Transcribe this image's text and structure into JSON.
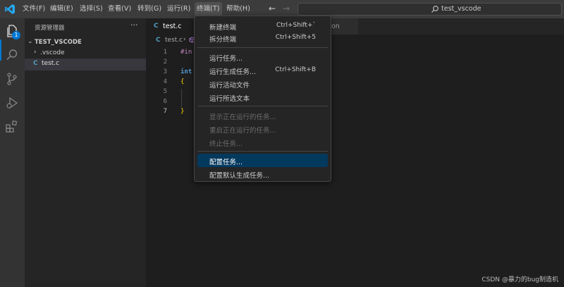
{
  "menubar": {
    "items": [
      "文件(F)",
      "编辑(E)",
      "选择(S)",
      "查看(V)",
      "转到(G)",
      "运行(R)",
      "终端(T)",
      "帮助(H)"
    ],
    "active": "终端(T)"
  },
  "search": {
    "text": "test_vscode"
  },
  "activity_bar": {
    "explorer_badge": "1"
  },
  "sidebar": {
    "title": "资源管理器",
    "more": "···",
    "folder": "TEST_VSCODE",
    "items": [
      ".vscode",
      "test.c"
    ]
  },
  "tabs": [
    {
      "label": "test.c",
      "icon": "C"
    },
    {
      "label": "son"
    }
  ],
  "breadcrumb": {
    "file": "test.c",
    "sep": "›"
  },
  "editor": {
    "line_numbers": [
      "1",
      "2",
      "3",
      "4",
      "5",
      "6",
      "7"
    ],
    "lines": [
      {
        "text": "#in",
        "color": "#c586c0"
      },
      {
        "text": "",
        "color": "#d4d4d4"
      },
      {
        "text": "int",
        "color": "#569cd6"
      },
      {
        "text": "{",
        "color": "#ffd700"
      },
      {
        "text": "",
        "color": "#d4d4d4"
      },
      {
        "text": "",
        "color": "#d4d4d4"
      },
      {
        "text": "}",
        "color": "#ffd700"
      }
    ]
  },
  "terminal_menu": {
    "items": [
      {
        "label": "新建终端",
        "shortcut": "Ctrl+Shift+`"
      },
      {
        "label": "拆分终端",
        "shortcut": "Ctrl+Shift+5"
      },
      {
        "label": "运行任务..."
      },
      {
        "label": "运行生成任务...",
        "shortcut": "Ctrl+Shift+B"
      },
      {
        "label": "运行活动文件"
      },
      {
        "label": "运行所选文本"
      },
      {
        "label": "显示正在运行的任务..."
      },
      {
        "label": "重启正在运行的任务..."
      },
      {
        "label": "终止任务..."
      },
      {
        "label": "配置任务..."
      },
      {
        "label": "配置默认生成任务..."
      }
    ],
    "highlighted": "配置任务..."
  },
  "watermark": "CSDN @暴力的bug制造机",
  "colors": {
    "accent": "#0078d4",
    "highlight": "#04395e",
    "c_icon": "#519aba",
    "background": "#1e1e1e"
  }
}
